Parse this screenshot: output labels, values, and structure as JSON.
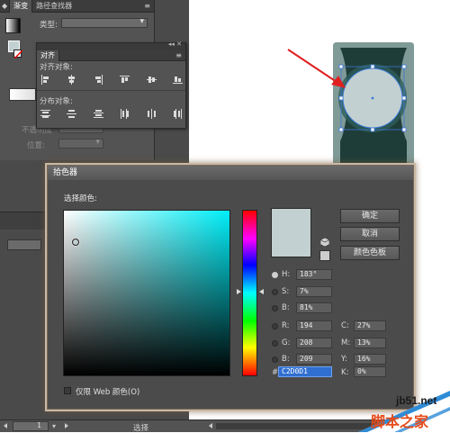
{
  "gradient_panel": {
    "tabs": [
      "渐变",
      "路径查找器"
    ],
    "type_label": "类型:",
    "opacity_label": "不透明度",
    "position_label": "位置:"
  },
  "align_panel": {
    "tab": "对齐",
    "align_objects_label": "对齐对象:",
    "distribute_objects_label": "分布对象:"
  },
  "picker": {
    "title": "拾色器",
    "select_color_label": "选择颜色:",
    "buttons": {
      "ok": "确定",
      "cancel": "取消",
      "swatches": "颜色色板"
    },
    "fields": {
      "H": {
        "label": "H:",
        "value": "183°"
      },
      "S": {
        "label": "S:",
        "value": "7%"
      },
      "B": {
        "label": "B:",
        "value": "81%"
      },
      "R": {
        "label": "R:",
        "value": "194"
      },
      "G": {
        "label": "G:",
        "value": "208"
      },
      "Bl": {
        "label": "B:",
        "value": "209"
      },
      "C": {
        "label": "C:",
        "value": "27%"
      },
      "M": {
        "label": "M:",
        "value": "13%"
      },
      "Y": {
        "label": "Y:",
        "value": "16%"
      },
      "K": {
        "label": "K:",
        "value": "0%"
      }
    },
    "hex_label": "#",
    "hex_value": "C2D0D1",
    "web_only_label": "仅限 Web 颜色(O)",
    "hue_marker_fraction": 0.49,
    "sv_marker": {
      "s": 0.07,
      "b": 0.81
    }
  },
  "status_bar": {
    "zoom": "1",
    "mode": "选择"
  },
  "watermark": {
    "site": "jb51.net",
    "name": "脚本之家"
  },
  "colors": {
    "accent_selection": "#C2D0D1",
    "object_dark": "#1f3d38",
    "object_mid": "#7f9a97",
    "arrow": "#e02020"
  }
}
